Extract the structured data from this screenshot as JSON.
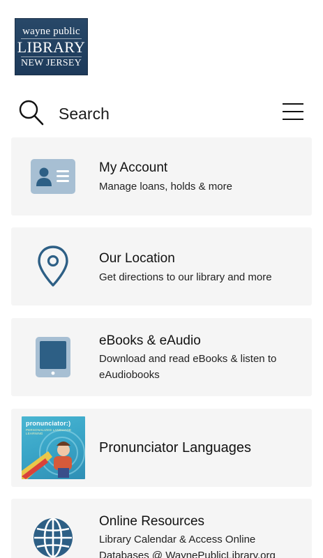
{
  "logo": {
    "line1": "wayne public",
    "line2": "LIBRARY",
    "line3": "NEW JERSEY"
  },
  "search": {
    "label": "Search"
  },
  "colors": {
    "icon_blue": "#2d5f85",
    "icon_light": "#a7bfd3",
    "card_bg": "#f5f5f5"
  },
  "menu": {
    "items": [
      {
        "title": "My Account",
        "description": "Manage loans, holds & more",
        "icon": "account-card-icon"
      },
      {
        "title": "Our Location",
        "description": "Get directions to our library and more",
        "icon": "location-pin-icon"
      },
      {
        "title": "eBooks & eAudio",
        "description": "Download and read eBooks & listen to eAudiobooks",
        "icon": "tablet-icon"
      },
      {
        "title": "Pronunciator Languages",
        "description": "",
        "icon": "pronunciator-thumbnail",
        "thumb_brand": "pronunciator:)",
        "thumb_tag": "PERSONALIZED LANGUAGE LEARNING"
      },
      {
        "title": "Online Resources",
        "description": "Library Calendar & Access Online Databases @ WaynePublicLibrary.org",
        "icon": "globe-icon"
      }
    ]
  }
}
